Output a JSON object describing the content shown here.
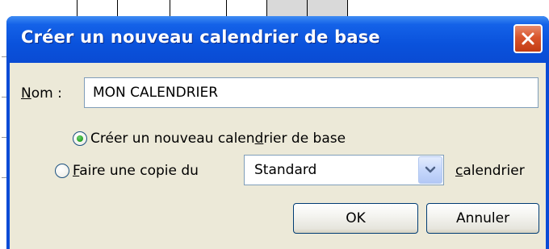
{
  "dialog": {
    "title": "Créer un nouveau calendrier de base",
    "close_icon": "close-icon",
    "name_label_mnemonic": "N",
    "name_label_rest": "om :",
    "name_value": "MON CALENDRIER",
    "option_new": {
      "label_before": "Créer un nouveau calen",
      "mnemonic": "d",
      "label_after": "rier de base",
      "checked": true
    },
    "option_copy": {
      "mnemonic": "F",
      "label_after": "aire une copie du",
      "checked": false
    },
    "copy_select_value": "Standard",
    "after_select_mnemonic": "c",
    "after_select_rest": "alendrier",
    "ok_label": "OK",
    "cancel_label": "Annuler"
  },
  "colors": {
    "titlebar": "#0a52dc",
    "close_button": "#d9552c",
    "client_bg": "#ece9d8",
    "radio_check": "#21a121"
  }
}
